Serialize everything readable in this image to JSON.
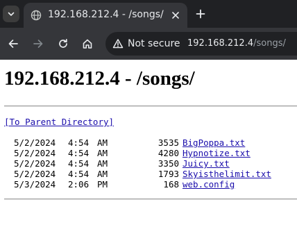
{
  "browser": {
    "tab": {
      "title": "192.168.212.4 - /songs/"
    },
    "address_bar": {
      "security_label": "Not secure",
      "url_host": "192.168.212.4",
      "url_path": "/songs/"
    }
  },
  "page": {
    "heading": "192.168.212.4 - /songs/",
    "parent_link": "[To Parent Directory]",
    "files": [
      {
        "date": "5/2/2024",
        "time": "4:54",
        "ampm": "AM",
        "size": "3535",
        "name": "BigPoppa.txt"
      },
      {
        "date": "5/2/2024",
        "time": "4:54",
        "ampm": "AM",
        "size": "4280",
        "name": "Hypnotize.txt"
      },
      {
        "date": "5/2/2024",
        "time": "4:54",
        "ampm": "AM",
        "size": "3350",
        "name": "Juicy.txt"
      },
      {
        "date": "5/2/2024",
        "time": "4:54",
        "ampm": "AM",
        "size": "1793",
        "name": "Skyisthelimit.txt"
      },
      {
        "date": "5/3/2024",
        "time": "2:06",
        "ampm": "PM",
        "size": "168",
        "name": "web.config"
      }
    ]
  },
  "colors": {
    "tabstrip_bg": "#202124",
    "toolbar_bg": "#35363a",
    "link": "#1a0dab"
  }
}
